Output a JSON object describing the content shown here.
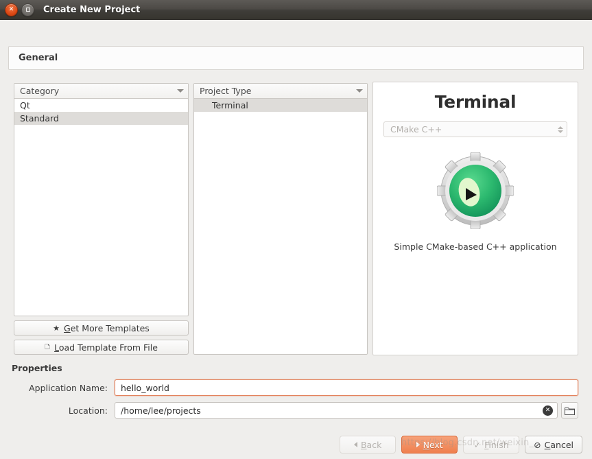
{
  "window": {
    "title": "Create New Project",
    "close_icon": "close-icon",
    "maximize_icon": "maximize-icon"
  },
  "section": {
    "header": "General"
  },
  "category_panel": {
    "header_label": "Category",
    "dropdown_icon": "chevron-down-icon",
    "items": [
      {
        "label": "Qt",
        "selected": false
      },
      {
        "label": "Standard",
        "selected": true
      }
    ],
    "buttons": [
      {
        "label": "Get More Templates",
        "icon": "star-icon",
        "accel": "G"
      },
      {
        "label": "Load Template From File",
        "icon": "document-icon",
        "accel": "L"
      }
    ]
  },
  "project_type_panel": {
    "header_label": "Project Type",
    "dropdown_icon": "chevron-down-icon",
    "items": [
      {
        "label": "Terminal",
        "selected": true
      }
    ]
  },
  "preview": {
    "title": "Terminal",
    "combo_value": "CMake C++",
    "combo_icon": "spinner-arrows-icon",
    "logo_icon": "kdevelop-gear-icon",
    "description": "Simple CMake-based C++ application",
    "colors": {
      "gear_outer": "#d8d8d8",
      "gear_inner_green": "#27b06a",
      "gear_highlight": "#d9f5c9"
    }
  },
  "properties": {
    "title": "Properties",
    "fields": [
      {
        "label": "Application Name:",
        "value": "hello_world",
        "placeholder": "",
        "focused": true
      },
      {
        "label": "Location:",
        "value": "/home/lee/projects",
        "placeholder": "",
        "focused": false,
        "clear_icon": "clear-icon",
        "browse_icon": "folder-icon"
      }
    ]
  },
  "footer": {
    "buttons": [
      {
        "label": "Back",
        "icon": "arrow-left-icon",
        "state": "disabled",
        "accel": "B"
      },
      {
        "label": "Next",
        "icon": "arrow-right-icon",
        "state": "primary",
        "accel": "N"
      },
      {
        "label": "Finish",
        "icon": "check-icon",
        "state": "disabled",
        "accel": "F"
      },
      {
        "label": "Cancel",
        "icon": "cancel-icon",
        "state": "normal",
        "accel": "C"
      }
    ]
  },
  "watermark": {
    "text": "https://blog.csdn.net/weixin_"
  },
  "theme": {
    "accent": "#ef7f4d",
    "focus_border": "#e2805a",
    "window_bg": "#efeeec",
    "titlebar": "#4d4a46"
  }
}
